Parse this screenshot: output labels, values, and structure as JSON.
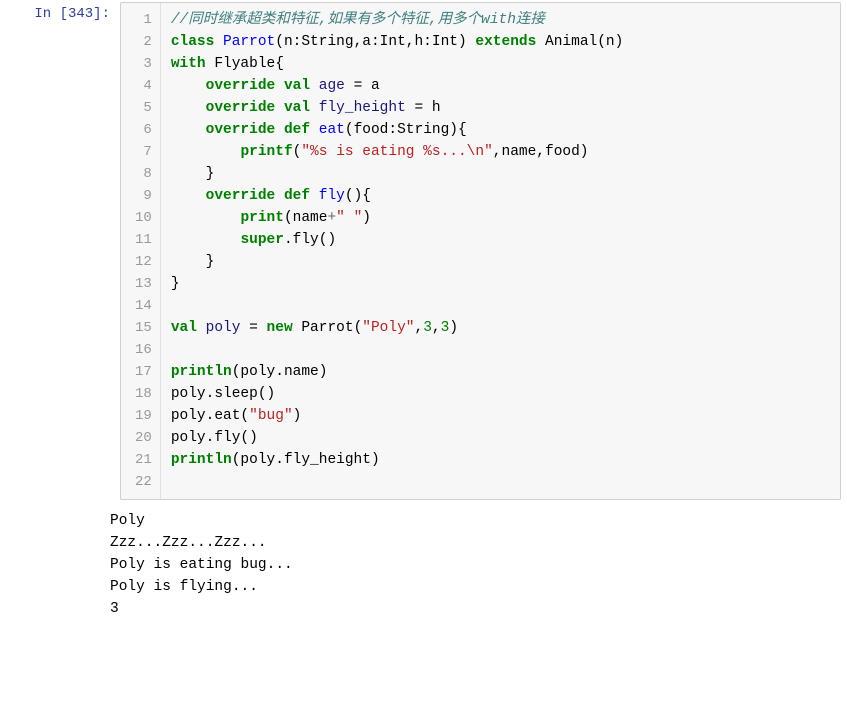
{
  "prompt": "In [343]:",
  "line_numbers": [
    "1",
    "2",
    "3",
    "4",
    "5",
    "6",
    "7",
    "8",
    "9",
    "10",
    "11",
    "12",
    "13",
    "14",
    "15",
    "16",
    "17",
    "18",
    "19",
    "20",
    "21",
    "22"
  ],
  "code": {
    "l1": {
      "a": "//同时继承超类和特征,如果有多个特征,用多个with连接"
    },
    "l2": {
      "a": "class",
      "b": " ",
      "c": "Parrot",
      "d": "(n:String,a:Int,h:Int) ",
      "e": "extends",
      "f": " Animal(n)"
    },
    "l3": {
      "a": "with",
      "b": " Flyable{"
    },
    "l4": {
      "pad": "    ",
      "a": "override",
      "b": " ",
      "c": "val",
      "d": " ",
      "e": "age",
      "f": " = a"
    },
    "l5": {
      "pad": "    ",
      "a": "override",
      "b": " ",
      "c": "val",
      "d": " ",
      "e": "fly_height",
      "f": " = h"
    },
    "l6": {
      "pad": "    ",
      "a": "override",
      "b": " ",
      "c": "def",
      "d": " ",
      "e": "eat",
      "f": "(food:String){"
    },
    "l7": {
      "pad": "        ",
      "a": "printf",
      "b": "(",
      "c": "\"%s is eating %s...\\n\"",
      "d": ",name,food)"
    },
    "l8": {
      "pad": "    ",
      "a": "}"
    },
    "l9": {
      "pad": "    ",
      "a": "override",
      "b": " ",
      "c": "def",
      "d": " ",
      "e": "fly",
      "f": "(){"
    },
    "l10": {
      "pad": "        ",
      "a": "print",
      "b": "(name",
      "c": "+",
      "d": "\" \"",
      "e": ")"
    },
    "l11": {
      "pad": "        ",
      "a": "super",
      "b": ".fly()"
    },
    "l12": {
      "pad": "    ",
      "a": "}"
    },
    "l13": {
      "a": "}"
    },
    "l14": {
      "a": ""
    },
    "l15": {
      "a": "val",
      "b": " ",
      "c": "poly",
      "d": " = ",
      "e": "new",
      "f": " Parrot(",
      "g": "\"Poly\"",
      "h": ",",
      "i": "3",
      "j": ",",
      "k": "3",
      "l": ")"
    },
    "l16": {
      "a": ""
    },
    "l17": {
      "a": "println",
      "b": "(poly.name)"
    },
    "l18": {
      "a": "poly.sleep()"
    },
    "l19": {
      "a": "poly.eat(",
      "b": "\"bug\"",
      "c": ")"
    },
    "l20": {
      "a": "poly.fly()"
    },
    "l21": {
      "a": "println",
      "b": "(poly.fly_height)"
    },
    "l22": {
      "a": ""
    }
  },
  "output": {
    "o1": "Poly",
    "o2": "Zzz...Zzz...Zzz...",
    "o3": "Poly is eating bug...",
    "o4": "Poly is flying...",
    "o5": "3"
  }
}
